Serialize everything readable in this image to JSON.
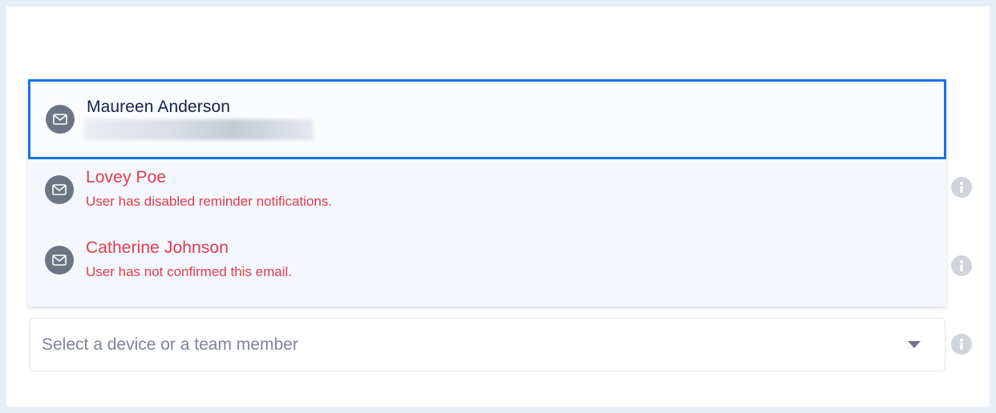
{
  "dropdown": {
    "options": [
      {
        "name": "Maureen Anderson",
        "subtext": "",
        "icon": "mail-icon",
        "state": "selected"
      },
      {
        "name": "Lovey Poe",
        "subtext": "User has disabled reminder notifications.",
        "icon": "mail-icon",
        "state": "warning"
      },
      {
        "name": "Catherine Johnson",
        "subtext": "User has not confirmed this email.",
        "icon": "mail-icon",
        "state": "warning"
      }
    ]
  },
  "select": {
    "placeholder": "Select a device or a team member",
    "icon": "chevron-down-icon"
  },
  "info_icon": "info-icon",
  "colors": {
    "accent": "#1874e8",
    "warning": "#e23a4f",
    "primary_text": "#14224a",
    "placeholder": "#7e8596",
    "avatar": "#6c7585"
  }
}
